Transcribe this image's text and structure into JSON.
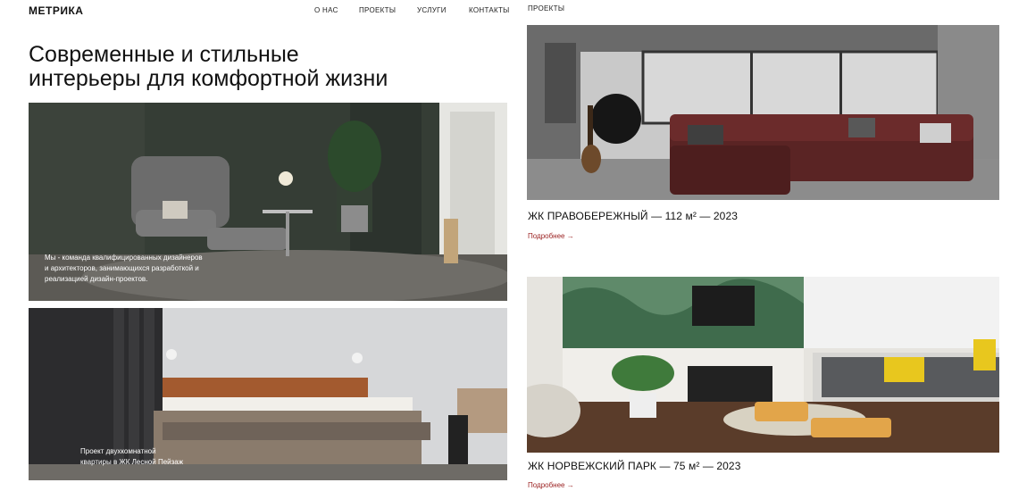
{
  "header": {
    "logo": "МЕТРИКА",
    "nav": [
      "О НАС",
      "ПРОЕКТЫ",
      "УСЛУГИ",
      "КОНТАКТЫ"
    ],
    "section_label": "ПРОЕКТЫ"
  },
  "hero": {
    "title_line1": "Современные и стильные",
    "title_line2": "интерьеры для комфортной жизни"
  },
  "left_cards": [
    {
      "text_lines": [
        "Мы - команда квалифицированных дизайнеров",
        "и архитекторов, занимающихся разработкой и",
        "реализацией дизайн-проектов."
      ]
    },
    {
      "text_lines": [
        "Проект двухкомнатной",
        "квартиры в ЖК Лесной Пейзаж"
      ]
    }
  ],
  "projects": [
    {
      "caption": "ЖК ПРАВОБЕРЕЖНЫЙ — 112 м² — 2023",
      "more": "Подробнее →"
    },
    {
      "caption": "ЖК НОРВЕЖСКИЙ ПАРК — 75 м² — 2023",
      "more": "Подробнее →"
    }
  ],
  "colors": {
    "accent": "#9a1f1f"
  }
}
